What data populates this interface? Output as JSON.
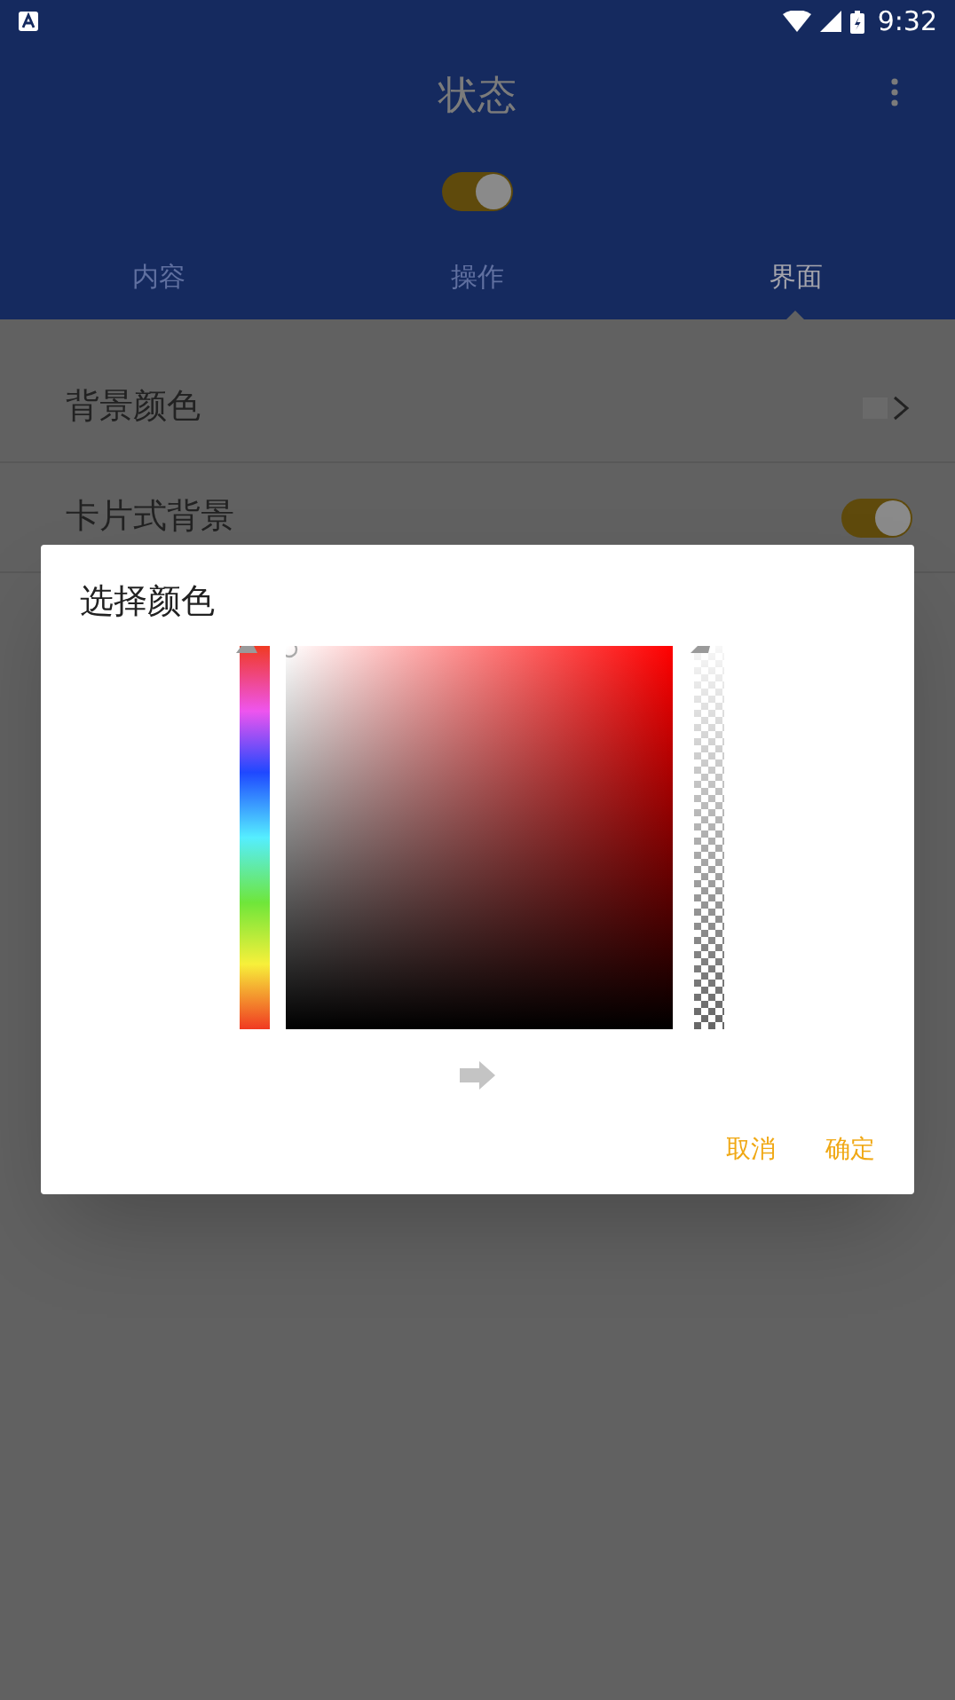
{
  "status_bar": {
    "time": "9:32"
  },
  "app_bar": {
    "title": "状态",
    "master_switch": {
      "on": true
    }
  },
  "tabs": [
    {
      "label": "内容",
      "selected": false
    },
    {
      "label": "操作",
      "selected": false
    },
    {
      "label": "界面",
      "selected": true
    }
  ],
  "settings": [
    {
      "kind": "color",
      "label": "背景颜色"
    },
    {
      "kind": "switch",
      "label": "卡片式背景",
      "on": true
    }
  ],
  "dialog": {
    "title": "选择颜色",
    "hue_slider": {
      "level": 0
    },
    "alpha_slider": {
      "level": 0
    },
    "buttons": [
      "取消",
      "确定"
    ]
  }
}
